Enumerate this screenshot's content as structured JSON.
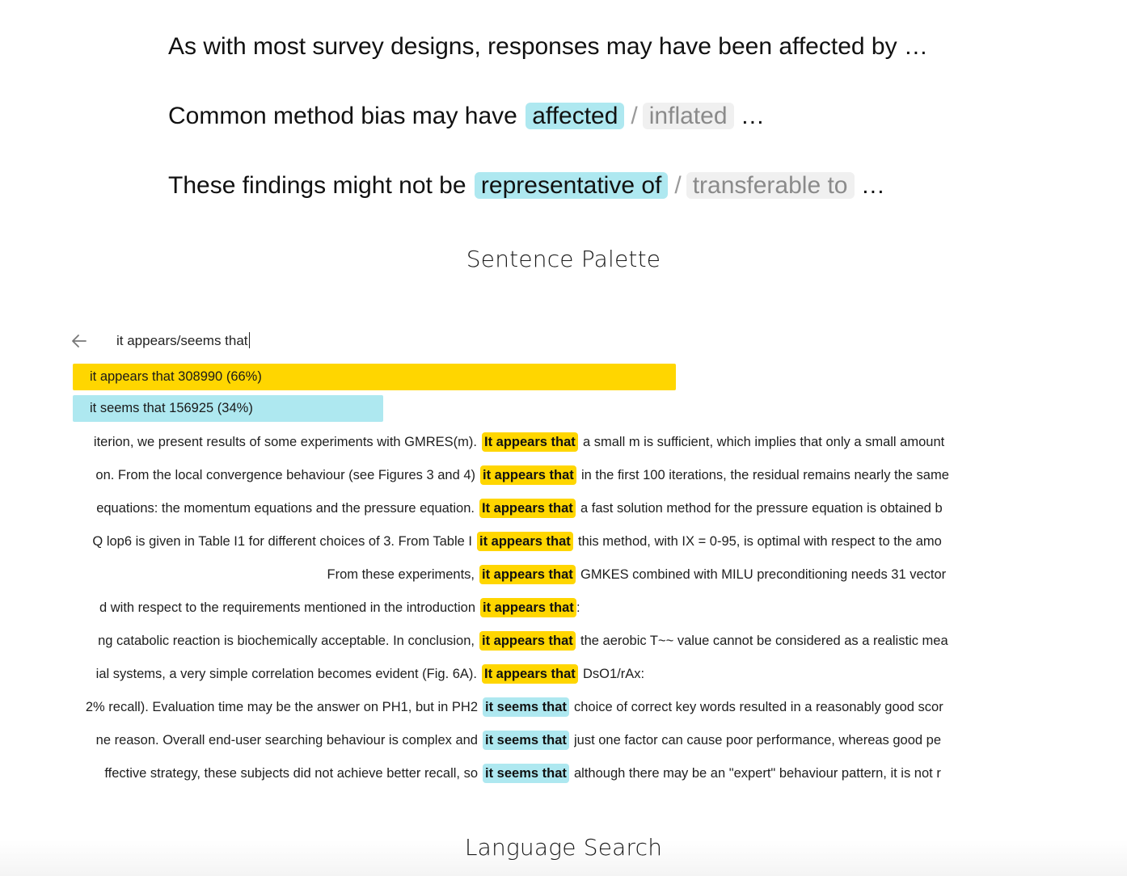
{
  "sentence_palette": {
    "caption": "Sentence Palette",
    "sentences": [
      {
        "prefix": "As with most survey designs, responses may have been affected by …",
        "chosen": "",
        "separator": "",
        "alternative": "",
        "suffix": ""
      },
      {
        "prefix": "Common method bias may have",
        "chosen": "affected",
        "separator": "/",
        "alternative": "inflated",
        "suffix": "…"
      },
      {
        "prefix": "These findings might not be",
        "chosen": "representative of",
        "separator": "/",
        "alternative": "transferable to",
        "suffix": "…"
      }
    ]
  },
  "language_search": {
    "caption": "Language Search",
    "back_icon": "arrow-left-icon",
    "query": "it appears/seems that",
    "results": [
      {
        "phrase": "it appears that",
        "count": "308990",
        "percent_label": "(66%)",
        "share": 0.66,
        "color": "#ffd600"
      },
      {
        "phrase": "it seems that",
        "count": "156925",
        "percent_label": "(34%)",
        "share": 0.34,
        "color": "#aee8f0"
      }
    ],
    "concordance": [
      {
        "left": "iterion, we present results of some experiments with GMRES(m).",
        "keyword": "It appears that",
        "right": "a small m is sufficient, which implies that only a small amount",
        "type": "appears"
      },
      {
        "left": "on. From the local convergence behaviour (see Figures 3 and 4)",
        "keyword": "it appears that",
        "right": "in the first 100 iterations, the residual remains nearly the same",
        "type": "appears"
      },
      {
        "left": "equations: the momentum equations and the pressure equation.",
        "keyword": "It appears that",
        "right": "a fast solution method for the pressure equation is obtained b",
        "type": "appears"
      },
      {
        "left": "Q lop6 is given in Table I1 for different choices of 3. From Table I",
        "keyword": "it appears that",
        "right": "this method, with IX = 0-95, is optimal with respect to the amo",
        "type": "appears"
      },
      {
        "left": "From these experiments,",
        "keyword": "it appears that",
        "right": "GMKES combined with MILU preconditioning needs 31 vector",
        "type": "appears"
      },
      {
        "left": "d with respect to the requirements mentioned in the introduction",
        "keyword": "it appears that",
        "right": ":",
        "type": "appears"
      },
      {
        "left": "ng catabolic reaction is biochemically acceptable. In conclusion,",
        "keyword": "it appears that",
        "right": "the aerobic T~~ value cannot be considered as a realistic mea",
        "type": "appears"
      },
      {
        "left": "ial systems, a very simple correlation becomes evident (Fig. 6A).",
        "keyword": "It appears that",
        "right": "DsO1/rAx:",
        "type": "appears"
      },
      {
        "left": "2% recall). Evaluation time may be the answer on PH1, but in PH2",
        "keyword": "it seems that",
        "right": "choice of correct key words resulted in a reasonably good scor",
        "type": "seems"
      },
      {
        "left": "ne reason. Overall end-user searching behaviour is complex and",
        "keyword": "it seems that",
        "right": "just one factor can cause poor performance, whereas good pe",
        "type": "seems"
      },
      {
        "left": "ffective strategy, these subjects did not achieve better recall, so",
        "keyword": "it seems that",
        "right": "although there may be an \"expert\" behaviour pattern, it is not r",
        "type": "seems"
      }
    ]
  }
}
